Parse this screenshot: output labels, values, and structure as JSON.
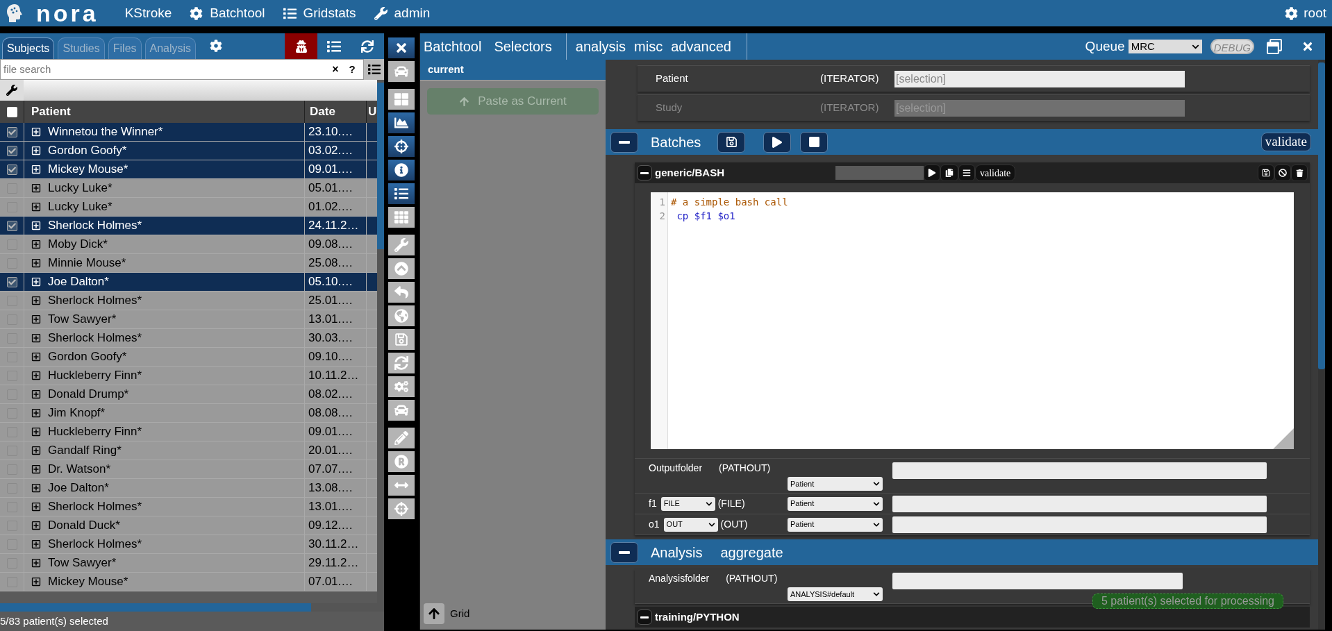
{
  "topbar": {
    "brand": "nora",
    "project": "KStroke",
    "menu": [
      {
        "kind": "gear",
        "label": "Batchtool"
      },
      {
        "kind": "list",
        "label": "Gridstats"
      },
      {
        "kind": "wrench",
        "label": "admin"
      }
    ],
    "user": "root"
  },
  "left_panel": {
    "tabs": [
      {
        "label": "Subjects",
        "selected": true
      },
      {
        "label": "Studies",
        "selected": false
      },
      {
        "label": "Files",
        "selected": false
      },
      {
        "label": "Analysis",
        "selected": false
      }
    ],
    "incognito": true,
    "search": {
      "placeholder": "file search",
      "clear": "×",
      "help": "?"
    },
    "table": {
      "all_checked": false,
      "columns": [
        "Patient",
        "Date",
        "U"
      ],
      "rows": [
        {
          "patient": "Winnetou the Winner*",
          "date": "23.10.…",
          "selected": true
        },
        {
          "patient": "Gordon Goofy*",
          "date": "03.02.…",
          "selected": true
        },
        {
          "patient": "Mickey Mouse*",
          "date": "09.01.…",
          "selected": true
        },
        {
          "patient": "Lucky Luke*",
          "date": "05.01.…",
          "selected": false
        },
        {
          "patient": "Lucky Luke*",
          "date": "01.02.…",
          "selected": false
        },
        {
          "patient": "Sherlock Holmes*",
          "date": "24.11.2…",
          "selected": true
        },
        {
          "patient": "Moby Dick*",
          "date": "09.08.…",
          "selected": false
        },
        {
          "patient": "Minnie Mouse*",
          "date": "25.08.…",
          "selected": false
        },
        {
          "patient": "Joe Dalton*",
          "date": "05.10.…",
          "selected": true
        },
        {
          "patient": "Sherlock Holmes*",
          "date": "25.01.…",
          "selected": false
        },
        {
          "patient": "Tow Sawyer*",
          "date": "13.01.…",
          "selected": false
        },
        {
          "patient": "Sherlock Holmes*",
          "date": "30.03.…",
          "selected": false
        },
        {
          "patient": "Gordon Goofy*",
          "date": "09.10.…",
          "selected": false
        },
        {
          "patient": "Huckleberry Finn*",
          "date": "10.11.2…",
          "selected": false
        },
        {
          "patient": "Donald Drump*",
          "date": "08.02.…",
          "selected": false
        },
        {
          "patient": "Jim Knopf*",
          "date": "08.08.…",
          "selected": false
        },
        {
          "patient": "Huckleberry Finn*",
          "date": "09.01.…",
          "selected": false
        },
        {
          "patient": "Gandalf Ring*",
          "date": "20.01.…",
          "selected": false
        },
        {
          "patient": "Dr. Watson*",
          "date": "07.07.…",
          "selected": false
        },
        {
          "patient": "Joe Dalton*",
          "date": "13.08.…",
          "selected": false
        },
        {
          "patient": "Sherlock Holmes*",
          "date": "13.01.…",
          "selected": false
        },
        {
          "patient": "Donald Duck*",
          "date": "09.12.…",
          "selected": false
        },
        {
          "patient": "Sherlock Holmes*",
          "date": "30.11.2…",
          "selected": false
        },
        {
          "patient": "Tow Sawyer*",
          "date": "29.11.2…",
          "selected": false
        },
        {
          "patient": "Mickey Mouse*",
          "date": "07.01.…",
          "selected": false
        }
      ]
    },
    "status": "5/83 patient(s) selected"
  },
  "toolbar_groups": [
    [
      {
        "active": true
      },
      {
        "active": false
      }
    ],
    [
      {
        "active": false
      },
      {
        "active": true
      },
      {
        "active": true
      },
      {
        "active": true
      },
      {
        "active": true
      },
      {
        "active": false
      }
    ],
    [
      {
        "active": false
      },
      {
        "active": false
      },
      {
        "active": false
      },
      {
        "active": false
      },
      {
        "active": false
      },
      {
        "active": false
      },
      {
        "active": false
      },
      {
        "active": false
      }
    ],
    [
      {
        "active": false
      },
      {
        "active": false
      },
      {
        "active": false
      },
      {
        "active": false
      }
    ]
  ],
  "window": {
    "tabs": [
      "Batchtool",
      "Selectors"
    ],
    "menus": [
      "analysis",
      "misc",
      "advanced"
    ],
    "queue": {
      "label": "Queue",
      "value": "MRC"
    },
    "debug": {
      "label": "DEBUG",
      "on": false
    },
    "selectors": {
      "title": "current",
      "paste_button": "Paste as Current",
      "grid_button": "Grid"
    },
    "iterators": [
      {
        "name": "Patient",
        "type": "(ITERATOR)",
        "placeholder": "[selection]",
        "disabled": false
      },
      {
        "name": "Study",
        "type": "(ITERATOR)",
        "placeholder": "[selection]",
        "disabled": true
      }
    ],
    "batches": {
      "title": "Batches",
      "validate": "validate",
      "jobs": [
        {
          "name": "generic/BASH",
          "validate": "validate",
          "level": 0,
          "code": [
            {
              "number": "1",
              "kind": "comment",
              "text": "# a simple bash call"
            },
            {
              "number": "2",
              "kind": "command",
              "text": " cp $f1 $o1"
            }
          ],
          "params": [
            {
              "kind": "pathout",
              "name": "Outputfolder",
              "type": "(PATHOUT)",
              "source": "Patient"
            },
            {
              "kind": "typed",
              "name": "f1",
              "format": "FILE",
              "type": "(FILE)",
              "source": "Patient"
            },
            {
              "kind": "typed",
              "name": "o1",
              "format": "OUT",
              "type": "(OUT)",
              "source": "Patient"
            }
          ]
        }
      ]
    },
    "analysis": {
      "title": "Analysis",
      "subtitle": "aggregate",
      "params": [
        {
          "kind": "pathout",
          "name": "Analysisfolder",
          "type": "(PATHOUT)",
          "source": "ANALYSIS#default"
        }
      ],
      "next_job": "training/PYTHON"
    },
    "toast": "5 patient(s) selected for processing"
  }
}
